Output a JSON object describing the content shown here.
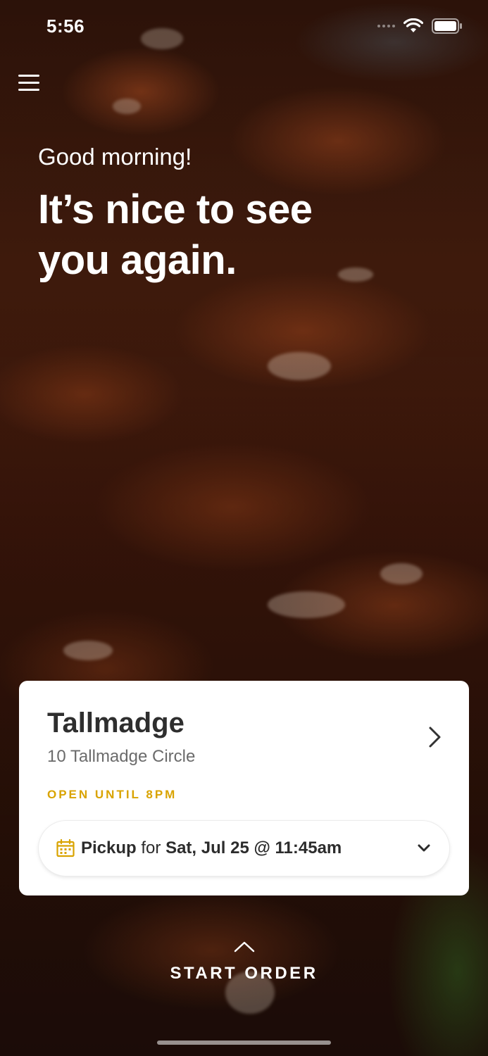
{
  "status_bar": {
    "time": "5:56"
  },
  "hero": {
    "greeting": "Good morning!",
    "headline": "It’s nice to see you again."
  },
  "location": {
    "name": "Tallmadge",
    "address": "10 Tallmadge Circle",
    "hours": "OPEN UNTIL 8PM"
  },
  "pickup": {
    "mode": "Pickup",
    "connector": "for",
    "datetime": "Sat, Jul 25 @ 11:45am"
  },
  "cta": {
    "label": "START ORDER"
  },
  "colors": {
    "accent_gold": "#d9a300",
    "card_bg": "#ffffff"
  },
  "icons": {
    "menu": "hamburger-menu-icon",
    "calendar": "calendar-icon",
    "chevron_right": "chevron-right-icon",
    "chevron_down": "chevron-down-icon",
    "chevron_up": "chevron-up-icon"
  }
}
